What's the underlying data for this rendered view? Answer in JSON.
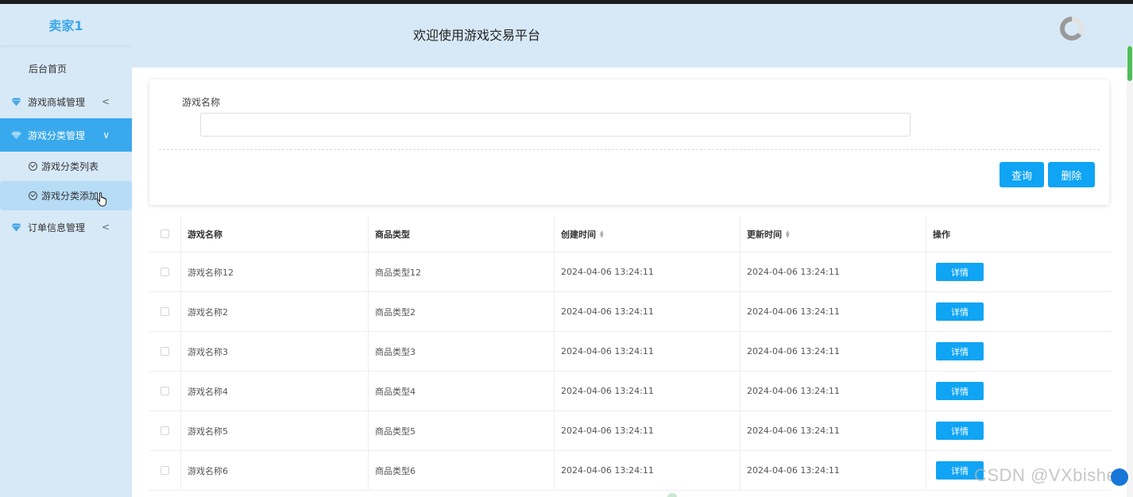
{
  "sidebar": {
    "brand": "卖家1",
    "home": "后台首页",
    "groups": [
      {
        "label": "游戏商城管理",
        "chevron": "<"
      },
      {
        "label": "游戏分类管理",
        "chevron": "∨"
      },
      {
        "label": "订单信息管理",
        "chevron": "<"
      }
    ],
    "subitems": [
      {
        "label": "游戏分类列表"
      },
      {
        "label": "游戏分类添加"
      }
    ]
  },
  "header": {
    "title": "欢迎使用游戏交易平台"
  },
  "search": {
    "label": "游戏名称",
    "value": "",
    "query_label": "查询",
    "delete_label": "删除"
  },
  "table": {
    "columns": [
      "游戏名称",
      "商品类型",
      "创建时间",
      "更新时间",
      "操作"
    ],
    "detail_label": "详情",
    "rows": [
      {
        "name": "游戏名称12",
        "type": "商品类型12",
        "created": "2024-04-06 13:24:11",
        "updated": "2024-04-06 13:24:11"
      },
      {
        "name": "游戏名称2",
        "type": "商品类型2",
        "created": "2024-04-06 13:24:11",
        "updated": "2024-04-06 13:24:11"
      },
      {
        "name": "游戏名称3",
        "type": "商品类型3",
        "created": "2024-04-06 13:24:11",
        "updated": "2024-04-06 13:24:11"
      },
      {
        "name": "游戏名称4",
        "type": "商品类型4",
        "created": "2024-04-06 13:24:11",
        "updated": "2024-04-06 13:24:11"
      },
      {
        "name": "游戏名称5",
        "type": "商品类型5",
        "created": "2024-04-06 13:24:11",
        "updated": "2024-04-06 13:24:11"
      },
      {
        "name": "游戏名称6",
        "type": "商品类型6",
        "created": "2024-04-06 13:24:11",
        "updated": "2024-04-06 13:24:11"
      }
    ]
  },
  "watermark": "CSDN @VXbishe",
  "colors": {
    "accent": "#0fa4f4",
    "sidebar_bg": "#d7e9f7",
    "active_bg": "#39a9ee",
    "brand": "#3ba7e8"
  }
}
